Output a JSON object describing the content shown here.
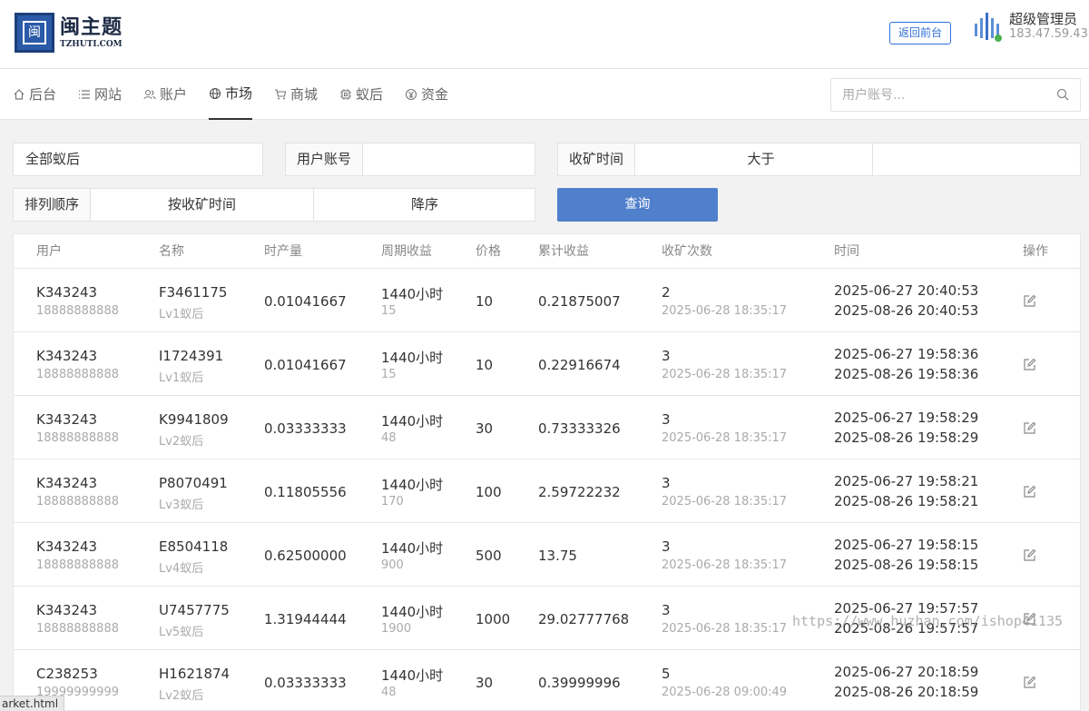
{
  "header": {
    "logo_title": "闽主题",
    "logo_sub": "TZHUTI.COM",
    "logo_glyph": "闽",
    "back_button": "返回前台",
    "admin_name": "超级管理员",
    "admin_ip": "183.47.59.43"
  },
  "nav": {
    "items": [
      {
        "label": "后台",
        "icon": "home-icon"
      },
      {
        "label": "网站",
        "icon": "list-icon"
      },
      {
        "label": "账户",
        "icon": "users-icon"
      },
      {
        "label": "市场",
        "icon": "globe-icon"
      },
      {
        "label": "商城",
        "icon": "cart-icon"
      },
      {
        "label": "蚁后",
        "icon": "chip-icon"
      },
      {
        "label": "资金",
        "icon": "coin-icon"
      }
    ],
    "active": "市场",
    "search_placeholder": "用户账号..."
  },
  "filters": {
    "queen_select": "全部蚁后",
    "account_label": "用户账号",
    "account_value": "",
    "time_label": "收矿时间",
    "time_op": "大于",
    "time_value": "",
    "sort_label": "排列顺序",
    "sort_field": "按收矿时间",
    "sort_dir": "降序",
    "query_button": "查询"
  },
  "table": {
    "headers": [
      "用户",
      "名称",
      "时产量",
      "周期收益",
      "价格",
      "累计收益",
      "收矿次数",
      "时间",
      "操作"
    ],
    "rows": [
      {
        "user": "K343243",
        "phone": "18888888888",
        "name": "F3461175",
        "level": "Lv1蚁后",
        "rate": "0.01041667",
        "period": "1440小时",
        "period_income": "15",
        "price": "10",
        "total": "0.21875007",
        "count": "2",
        "count_time": "2025-06-28 18:35:17",
        "start": "2025-06-27 20:40:53",
        "end": "2025-08-26 20:40:53"
      },
      {
        "user": "K343243",
        "phone": "18888888888",
        "name": "I1724391",
        "level": "Lv1蚁后",
        "rate": "0.01041667",
        "period": "1440小时",
        "period_income": "15",
        "price": "10",
        "total": "0.22916674",
        "count": "3",
        "count_time": "2025-06-28 18:35:17",
        "start": "2025-06-27 19:58:36",
        "end": "2025-08-26 19:58:36"
      },
      {
        "user": "K343243",
        "phone": "18888888888",
        "name": "K9941809",
        "level": "Lv2蚁后",
        "rate": "0.03333333",
        "period": "1440小时",
        "period_income": "48",
        "price": "30",
        "total": "0.73333326",
        "count": "3",
        "count_time": "2025-06-28 18:35:17",
        "start": "2025-06-27 19:58:29",
        "end": "2025-08-26 19:58:29"
      },
      {
        "user": "K343243",
        "phone": "18888888888",
        "name": "P8070491",
        "level": "Lv3蚁后",
        "rate": "0.11805556",
        "period": "1440小时",
        "period_income": "170",
        "price": "100",
        "total": "2.59722232",
        "count": "3",
        "count_time": "2025-06-28 18:35:17",
        "start": "2025-06-27 19:58:21",
        "end": "2025-08-26 19:58:21"
      },
      {
        "user": "K343243",
        "phone": "18888888888",
        "name": "E8504118",
        "level": "Lv4蚁后",
        "rate": "0.62500000",
        "period": "1440小时",
        "period_income": "900",
        "price": "500",
        "total": "13.75",
        "count": "3",
        "count_time": "2025-06-28 18:35:17",
        "start": "2025-06-27 19:58:15",
        "end": "2025-08-26 19:58:15"
      },
      {
        "user": "K343243",
        "phone": "18888888888",
        "name": "U7457775",
        "level": "Lv5蚁后",
        "rate": "1.31944444",
        "period": "1440小时",
        "period_income": "1900",
        "price": "1000",
        "total": "29.02777768",
        "count": "3",
        "count_time": "2025-06-28 18:35:17",
        "start": "2025-06-27 19:57:57",
        "end": "2025-08-26 19:57:57"
      },
      {
        "user": "C238253",
        "phone": "19999999999",
        "name": "H1621874",
        "level": "Lv2蚁后",
        "rate": "0.03333333",
        "period": "1440小时",
        "period_income": "48",
        "price": "30",
        "total": "0.39999996",
        "count": "5",
        "count_time": "2025-06-28 09:00:49",
        "start": "2025-06-27 20:18:59",
        "end": "2025-08-26 20:18:59"
      }
    ]
  },
  "watermark": "https://www.huzhan.com/ishop41135",
  "status_url": "arket.html",
  "colors": {
    "accent": "#5080cc",
    "link": "#2f6fd6",
    "brand": "#2a5aa8"
  }
}
